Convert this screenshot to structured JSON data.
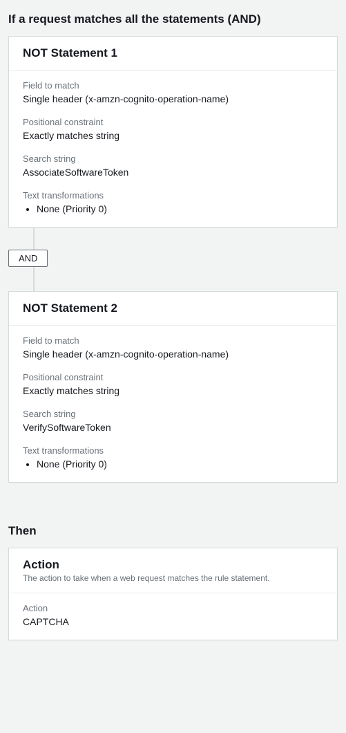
{
  "if_section": {
    "heading": "If a request matches all the statements (AND)",
    "connector_label": "AND",
    "statements": [
      {
        "title": "NOT Statement 1",
        "field_to_match_label": "Field to match",
        "field_to_match_value": "Single header (x-amzn-cognito-operation-name)",
        "positional_constraint_label": "Positional constraint",
        "positional_constraint_value": "Exactly matches string",
        "search_string_label": "Search string",
        "search_string_value": "AssociateSoftwareToken",
        "text_transformations_label": "Text transformations",
        "text_transformations_items": [
          "None (Priority 0)"
        ]
      },
      {
        "title": "NOT Statement 2",
        "field_to_match_label": "Field to match",
        "field_to_match_value": "Single header (x-amzn-cognito-operation-name)",
        "positional_constraint_label": "Positional constraint",
        "positional_constraint_value": "Exactly matches string",
        "search_string_label": "Search string",
        "search_string_value": "VerifySoftwareToken",
        "text_transformations_label": "Text transformations",
        "text_transformations_items": [
          "None (Priority 0)"
        ]
      }
    ]
  },
  "then_section": {
    "heading": "Then",
    "action_panel_title": "Action",
    "action_panel_subtitle": "The action to take when a web request matches the rule statement.",
    "action_label": "Action",
    "action_value": "CAPTCHA"
  }
}
